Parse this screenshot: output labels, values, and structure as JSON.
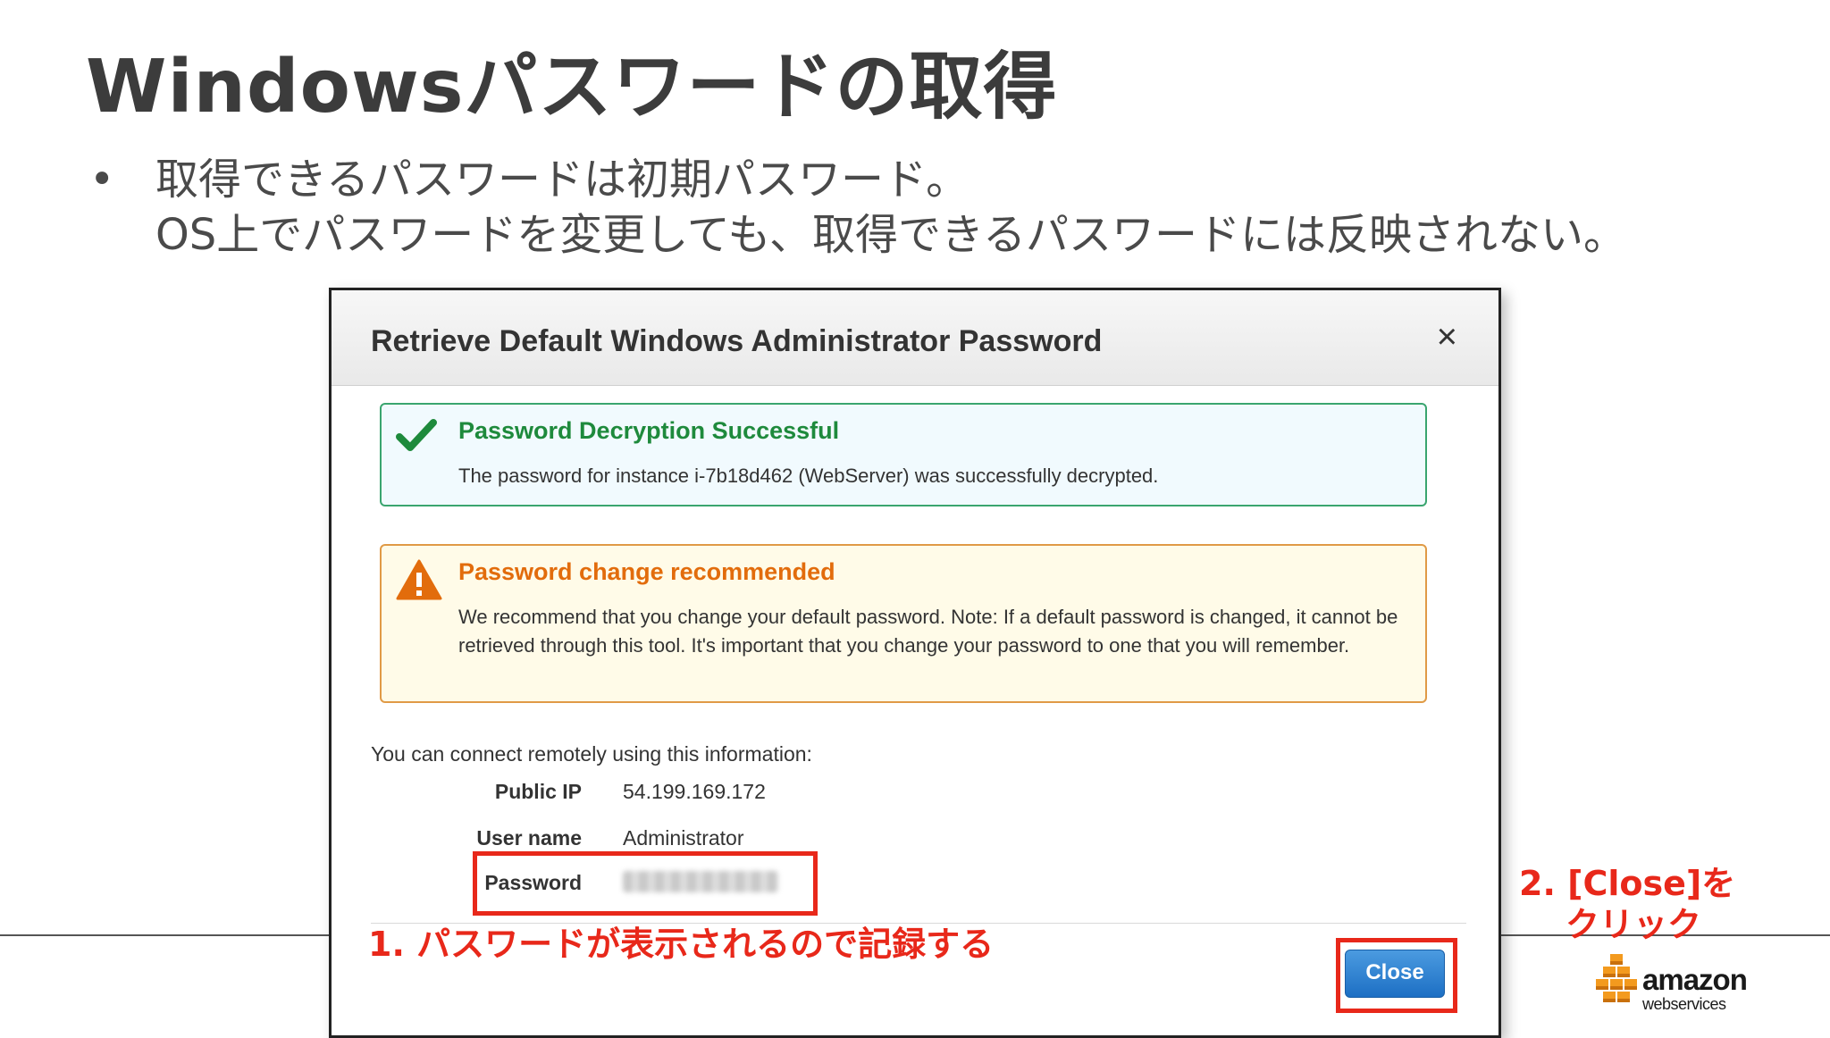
{
  "slide": {
    "title": "Windowsパスワードの取得",
    "bullet_marker": "•",
    "bullet_line1": "取得できるパスワードは初期パスワード。",
    "bullet_line2": "OS上でパスワードを変更しても、取得できるパスワードには反映されない。"
  },
  "dialog": {
    "title": "Retrieve Default Windows Administrator Password",
    "close_glyph": "×",
    "success": {
      "heading": "Password Decryption Successful",
      "body": "The password for instance i-7b18d462 (WebServer) was successfully decrypted."
    },
    "warning": {
      "heading": "Password change recommended",
      "body": "We recommend that you change your default password. Note: If a default password is changed, it cannot be retrieved through this tool. It's important that you change your password to one that you will remember."
    },
    "connect_intro": "You can connect remotely using this information:",
    "fields": {
      "public_ip_label": "Public IP",
      "public_ip_value": "54.199.169.172",
      "username_label": "User name",
      "username_value": "Administrator",
      "password_label": "Password"
    },
    "close_button": "Close"
  },
  "annotations": {
    "step1": "1. パスワードが表示されるので記録する",
    "step2_line1": "2. [Close]を",
    "step2_line2": "クリック"
  },
  "logo": {
    "word": "amazon",
    "sub": "webservices"
  },
  "colors": {
    "highlight": "#e8281a",
    "success": "#1e8a3c",
    "warning": "#e26c0c",
    "button": "#1d6fc4",
    "aws_orange": "#f39a1e"
  },
  "icons": [
    "checkmark-icon",
    "warning-icon",
    "close-icon",
    "aws-cubes-icon"
  ]
}
